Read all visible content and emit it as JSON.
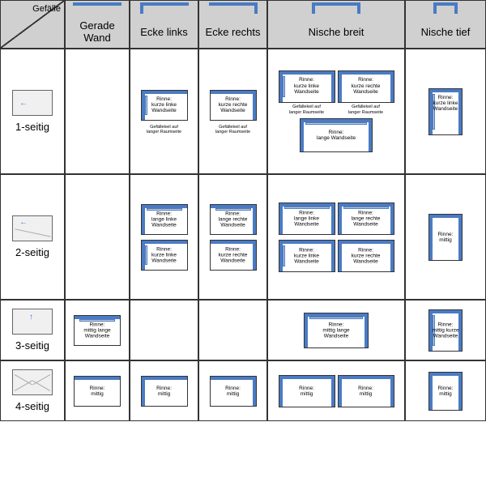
{
  "corner_label": "Gefälle",
  "col_headers": [
    "Gerade Wand",
    "Ecke links",
    "Ecke rechts",
    "Nische breit",
    "Nische tief"
  ],
  "row_headers": [
    "1-seitig",
    "2-seitig",
    "3-seitig",
    "4-seitig"
  ],
  "labels": {
    "rinne_kurz_links": "Rinne:\nkurze linke\nWandseite",
    "rinne_kurz_rechts": "Rinne:\nkurze rechte\nWandseite",
    "rinne_lang": "Rinne:\nlange Wandseite",
    "rinne_lang_links": "Rinne:\nlange linke\nWandseite",
    "rinne_lang_rechts": "Rinne:\nlange rechte\nWandseite",
    "rinne_mittig": "Rinne:\nmittig",
    "rinne_mittig_lang": "Rinne:\nmittig lange\nWandseite",
    "rinne_mittig_kurz": "Rinne:\nmittig kurze\nWandseite",
    "note_keil": "Gefällekeil auf\nlanger Raumseite"
  },
  "chart_data": {
    "type": "table",
    "title": "Gefälle / Wandkonfiguration Matrix",
    "row_labels": [
      "1-seitig",
      "2-seitig",
      "3-seitig",
      "4-seitig"
    ],
    "col_labels": [
      "Gerade Wand",
      "Ecke links",
      "Ecke rechts",
      "Nische breit",
      "Nische tief"
    ],
    "cells": [
      [
        "",
        "Rinne: kurze linke Wandseite (Gefällekeil auf langer Raumseite)",
        "Rinne: kurze rechte Wandseite (Gefällekeil auf langer Raumseite)",
        "Rinne: kurze linke Wandseite / Rinne: kurze rechte Wandseite (Gefällekeil auf langer Raumseite); Rinne: lange Wandseite",
        "Rinne: kurze linke Wandseite"
      ],
      [
        "",
        "Rinne: lange linke Wandseite; Rinne: kurze linke Wandseite",
        "Rinne: lange rechte Wandseite; Rinne: kurze rechte Wandseite",
        "Rinne: lange linke Wandseite / Rinne: lange rechte Wandseite; Rinne: kurze linke Wandseite / Rinne: kurze rechte Wandseite",
        "Rinne: mittig"
      ],
      [
        "Rinne: mittig lange Wandseite",
        "",
        "",
        "Rinne: mittig lange Wandseite",
        "Rinne: mittig kurze Wandseite"
      ],
      [
        "Rinne: mittig",
        "Rinne: mittig",
        "Rinne: mittig",
        "Rinne: mittig / Rinne: mittig",
        "Rinne: mittig"
      ]
    ]
  }
}
